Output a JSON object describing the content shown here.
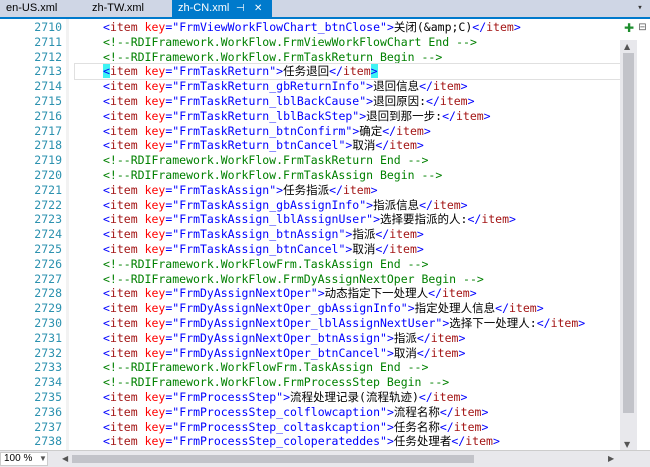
{
  "tabs": [
    {
      "label": "en-US.xml",
      "active": false
    },
    {
      "label": "zh-TW.xml",
      "active": false
    },
    {
      "label": "zh-CN.xml",
      "active": true
    }
  ],
  "zoom": "100 %",
  "colors": {
    "accent": "#007acc",
    "tag": "#a31515",
    "attr": "#ff0000",
    "string": "#0000ff",
    "comment": "#008000",
    "linenum": "#2b91af"
  },
  "lines": [
    {
      "num": "2710",
      "kind": "item",
      "key": "FrmViewWorkFlowChart_btnClose",
      "text": "关闭(&amp;C)"
    },
    {
      "num": "2711",
      "kind": "comment",
      "text": "<!--RDIFramework.WorkFlow.FrmViewWorkFlowChart End -->"
    },
    {
      "num": "2712",
      "kind": "comment",
      "text": "<!--RDIFramework.WorkFlow.FrmTaskReturn Begin -->"
    },
    {
      "num": "2713",
      "kind": "item",
      "key": "FrmTaskReturn",
      "text": "任务退回"
    },
    {
      "num": "2714",
      "kind": "item",
      "key": "FrmTaskReturn_gbReturnInfo",
      "text": "退回信息"
    },
    {
      "num": "2715",
      "kind": "item",
      "key": "FrmTaskReturn_lblBackCause",
      "text": "退回原因:"
    },
    {
      "num": "2716",
      "kind": "item",
      "key": "FrmTaskReturn_lblBackStep",
      "text": "退回到那一步:"
    },
    {
      "num": "2717",
      "kind": "item",
      "key": "FrmTaskReturn_btnConfirm",
      "text": "确定"
    },
    {
      "num": "2718",
      "kind": "item",
      "key": "FrmTaskReturn_btnCancel",
      "text": "取消"
    },
    {
      "num": "2719",
      "kind": "comment",
      "text": "<!--RDIFramework.WorkFlow.FrmTaskReturn End -->"
    },
    {
      "num": "2720",
      "kind": "comment",
      "text": "<!--RDIFramework.WorkFlow.FrmTaskAssign Begin -->"
    },
    {
      "num": "2721",
      "kind": "item",
      "key": "FrmTaskAssign",
      "text": "任务指派"
    },
    {
      "num": "2722",
      "kind": "item",
      "key": "FrmTaskAssign_gbAssignInfo",
      "text": "指派信息"
    },
    {
      "num": "2723",
      "kind": "item",
      "key": "FrmTaskAssign_lblAssignUser",
      "text": "选择要指派的人:"
    },
    {
      "num": "2724",
      "kind": "item",
      "key": "FrmTaskAssign_btnAssign",
      "text": "指派"
    },
    {
      "num": "2725",
      "kind": "item",
      "key": "FrmTaskAssign_btnCancel",
      "text": "取消"
    },
    {
      "num": "2726",
      "kind": "comment",
      "text": "<!--RDIFramework.WorkFlowFrm.TaskAssign End -->"
    },
    {
      "num": "2727",
      "kind": "comment",
      "text": "<!--RDIFramework.WorkFlow.FrmDyAssignNextOper Begin -->"
    },
    {
      "num": "2728",
      "kind": "item",
      "key": "FrmDyAssignNextOper",
      "text": "动态指定下一处理人"
    },
    {
      "num": "2729",
      "kind": "item",
      "key": "FrmDyAssignNextOper_gbAssignInfo",
      "text": "指定处理人信息"
    },
    {
      "num": "2730",
      "kind": "item",
      "key": "FrmDyAssignNextOper_lblAssignNextUser",
      "text": "选择下一处理人:"
    },
    {
      "num": "2731",
      "kind": "item",
      "key": "FrmDyAssignNextOper_btnAssign",
      "text": "指派"
    },
    {
      "num": "2732",
      "kind": "item",
      "key": "FrmDyAssignNextOper_btnCancel",
      "text": "取消"
    },
    {
      "num": "2733",
      "kind": "comment",
      "text": "<!--RDIFramework.WorkFlowFrm.TaskAssign End -->"
    },
    {
      "num": "2734",
      "kind": "comment",
      "text": "<!--RDIFramework.WorkFlow.FrmProcessStep Begin -->"
    },
    {
      "num": "2735",
      "kind": "item",
      "key": "FrmProcessStep",
      "text": "流程处理记录(流程轨迹)"
    },
    {
      "num": "2736",
      "kind": "item",
      "key": "FrmProcessStep_colflowcaption",
      "text": "流程名称"
    },
    {
      "num": "2737",
      "kind": "item",
      "key": "FrmProcessStep_coltaskcaption",
      "text": "任务名称"
    },
    {
      "num": "2738",
      "kind": "item",
      "key": "FrmProcessStep_coloperateddes",
      "text": "任务处理者"
    }
  ]
}
